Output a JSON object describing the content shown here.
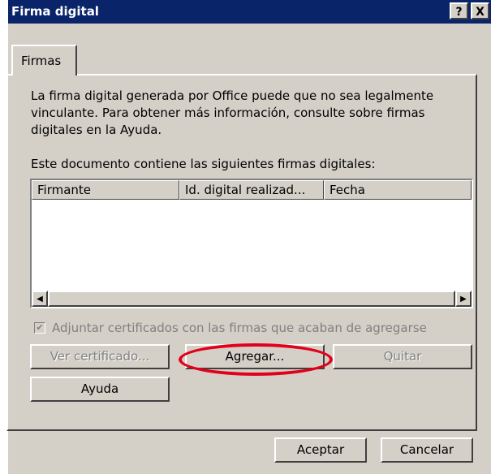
{
  "window": {
    "title": "Firma digital",
    "help_label": "?",
    "close_label": "X"
  },
  "tabs": [
    {
      "label": "Firmas"
    }
  ],
  "intro_text": "La firma digital generada por Office puede que no sea legalmente vinculante. Para obtener más información, consulte sobre firmas digitales en la Ayuda.",
  "list": {
    "caption": "Este documento contiene las siguientes firmas digitales:",
    "columns": [
      "Firmante",
      "Id. digital realizad...",
      "Fecha"
    ],
    "rows": [],
    "scroll_left": "◀",
    "scroll_right": "▶"
  },
  "attach_checkbox": {
    "label": "Adjuntar certificados con las firmas que acaban de agregarse",
    "checked": true,
    "enabled": false,
    "mark": "✔"
  },
  "buttons": {
    "ver_certificado": "Ver certificado...",
    "agregar": "Agregar...",
    "quitar": "Quitar",
    "ayuda": "Ayuda",
    "aceptar": "Aceptar",
    "cancelar": "Cancelar"
  },
  "colors": {
    "title_bar": "#0a246a",
    "face": "#d4d0c8",
    "highlight_ellipse": "#e2001a"
  }
}
